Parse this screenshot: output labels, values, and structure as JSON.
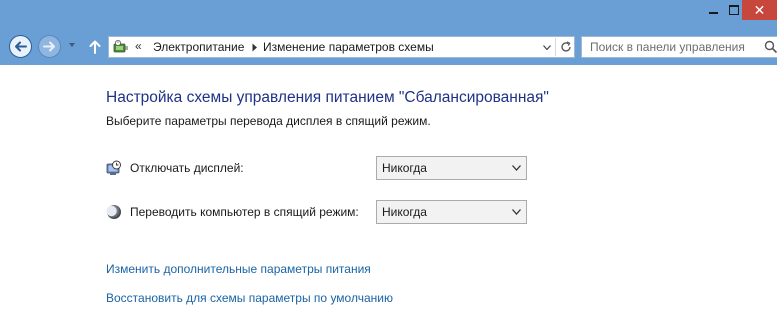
{
  "window": {
    "minimize_label": "",
    "maximize_label": "",
    "close_label": "✕"
  },
  "navigation": {
    "back_icon": "arrow-left-icon",
    "forward_icon": "arrow-right-icon",
    "up_icon": "arrow-up-icon",
    "address": {
      "icon": "power-options-icon",
      "overflow": "«",
      "breadcrumbs": [
        "Электропитание",
        "Изменение параметров схемы"
      ]
    },
    "search": {
      "placeholder": "Поиск в панели управления"
    }
  },
  "main": {
    "title": "Настройка схемы управления питанием \"Сбалансированная\"",
    "subtitle": "Выберите параметры перевода дисплея в спящий режим.",
    "settings": [
      {
        "icon": "display-timer-icon",
        "label": "Отключать дисплей:",
        "value": "Никогда"
      },
      {
        "icon": "sleep-moon-icon",
        "label": "Переводить компьютер в спящий режим:",
        "value": "Никогда"
      }
    ],
    "links": [
      "Изменить дополнительные параметры питания",
      "Восстановить для схемы параметры по умолчанию"
    ]
  },
  "colors": {
    "titlebar": "#6a9fd6",
    "close_button": "#c7473d",
    "title_text": "#1e3287",
    "link_text": "#1a64a6"
  }
}
